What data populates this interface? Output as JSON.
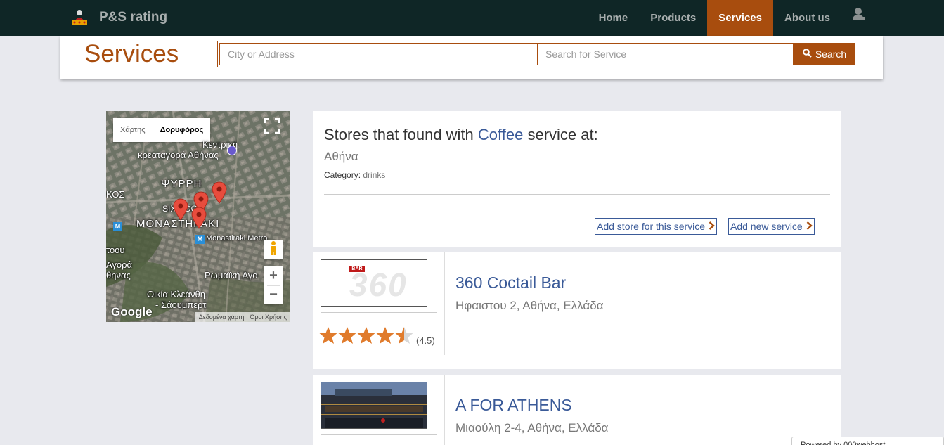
{
  "brand": {
    "name": "P&S rating",
    "logo_icon": "podium-user-icon"
  },
  "nav": {
    "items": [
      {
        "label": "Home",
        "active": false
      },
      {
        "label": "Products",
        "active": false
      },
      {
        "label": "Services",
        "active": true
      },
      {
        "label": "About us",
        "active": false
      }
    ],
    "user_icon": "user-icon"
  },
  "colors": {
    "navbar": "#0f2626",
    "accent": "#a84d0e",
    "link": "#3a5a98",
    "page_bg": "#e8e9ee"
  },
  "page_title": "Services",
  "search": {
    "city_placeholder": "City or Address",
    "service_placeholder": "Search for Service",
    "button_label": "Search",
    "button_icon": "search-icon"
  },
  "map": {
    "toggle": {
      "map_label": "Χάρτης",
      "satellite_label": "Δορυφόρος",
      "selected": "Δορυφόρος"
    },
    "labels": {
      "l1": "Κεντρική",
      "l2": "κρεαταγορά Αθήνας",
      "l3": "ΨΥΡΡΗ",
      "l4": "ΚΟΣ",
      "l5": "ΜΟΝΑΣΤΗΡΑΚΙ",
      "l6": "Monastiraki Metro",
      "l7": "τοου",
      "l8": "Αγορά",
      "l9": "θηνας",
      "l10": "Ρωμαϊκή Αγο",
      "l11": "Οικία Κλεάνθη",
      "l12": "- Σάουμπερτ",
      "l13": "SIX DOGS"
    },
    "google_label": "Google",
    "footer": {
      "data": "Δεδομένα χάρτη",
      "terms": "Όροι Χρήσης"
    },
    "controls": {
      "zoom_in": "+",
      "zoom_out": "−"
    }
  },
  "results": {
    "heading_prefix": "Stores that found with",
    "keyword": "Coffee",
    "heading_suffix": "service at:",
    "city": "Αθήνα",
    "category_label": "Category:",
    "category_value": "drinks",
    "add_store_label": "Add store for this service",
    "add_service_label": "Add new service"
  },
  "stores": [
    {
      "name": "360 Coctail Bar",
      "address": "Ηφαιστου 2, Αθήνα, Ελλάδα",
      "rating": 4.5,
      "rating_text": "(4.5)",
      "logo_badge": "BAR",
      "logo_text": "360"
    },
    {
      "name": "A FOR ATHENS",
      "address": "Μιαούλη 2-4, Αθήνα, Ελλάδα"
    }
  ],
  "footer_badge": "Powered by 000webhost"
}
